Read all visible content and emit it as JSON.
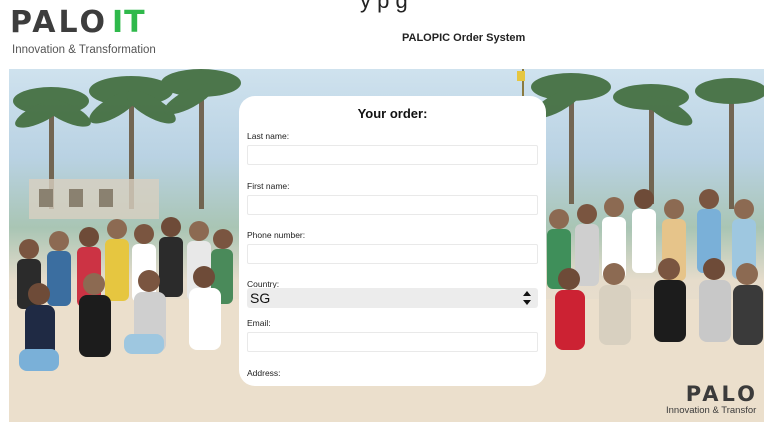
{
  "header": {
    "brand_name": "PALO",
    "brand_suffix": "IT",
    "brand_tagline": "Innovation & Transformation",
    "app_title": "PALOPIC Order System",
    "cut_off_text": "y                 p g"
  },
  "hero": {
    "logo_name": "PALO",
    "logo_tagline": "Innovation & Transfor"
  },
  "order_form": {
    "title": "Your order:",
    "last_name_label": "Last name:",
    "first_name_label": "First name:",
    "phone_label": "Phone number:",
    "country_label": "Country:",
    "country_value": "SG",
    "email_label": "Email:",
    "address_label": "Address:"
  },
  "colors": {
    "brand_green": "#2fb94b",
    "brand_gray": "#3d3d3d"
  }
}
